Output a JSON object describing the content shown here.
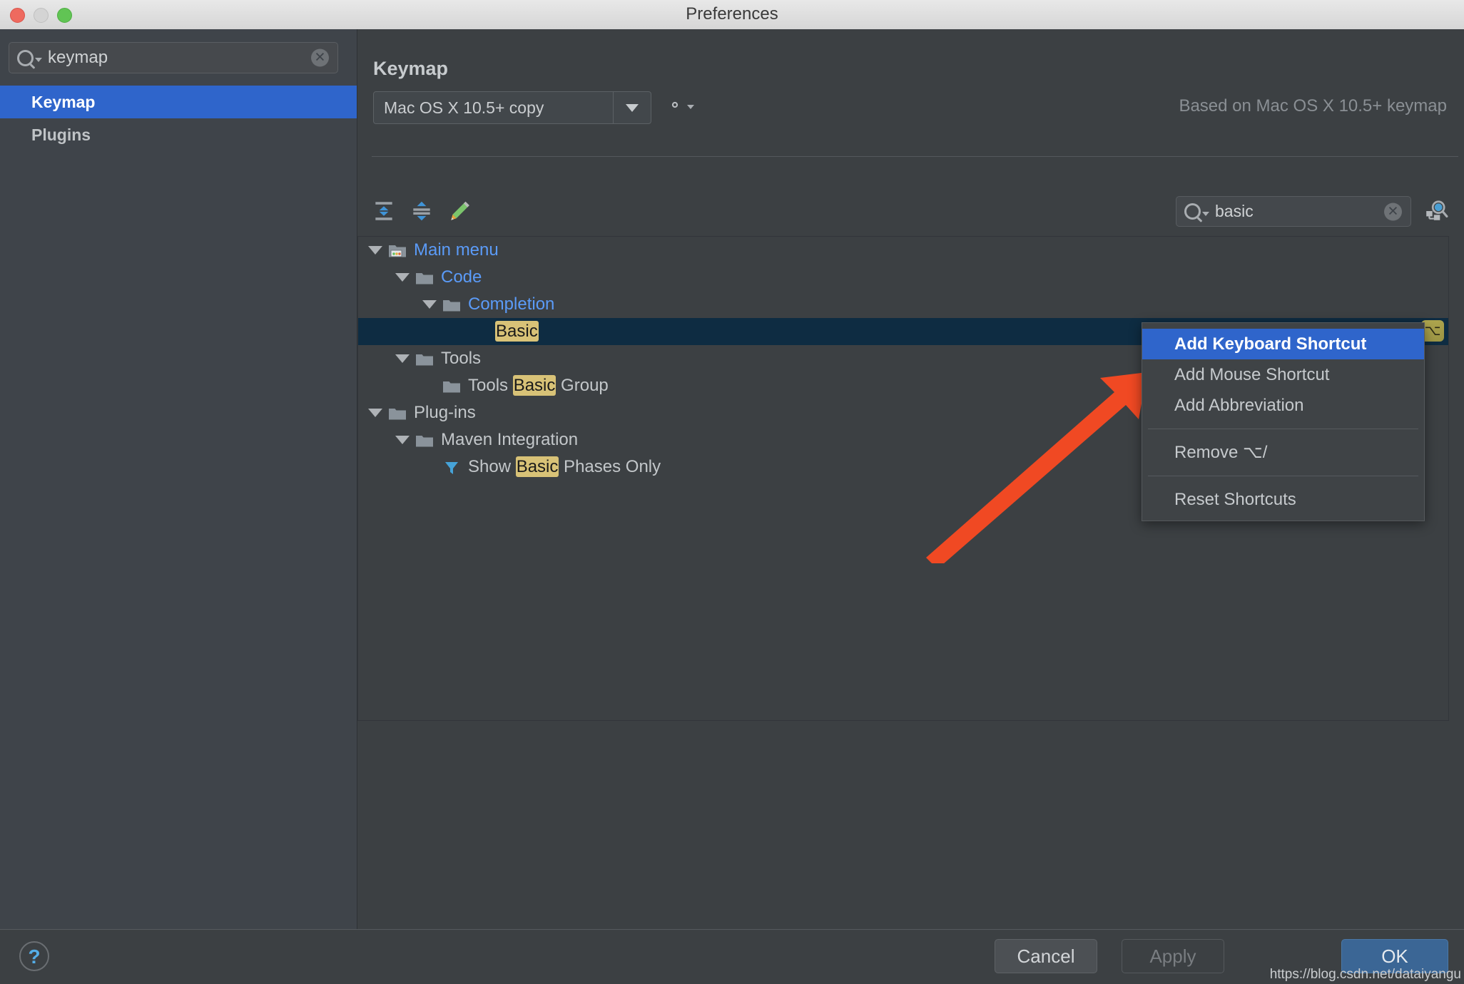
{
  "window": {
    "title": "Preferences",
    "traffic_lights": [
      "close-red",
      "minimize-yellow",
      "zoom-green"
    ]
  },
  "sidebar": {
    "search": {
      "value": "keymap",
      "icon": "search-icon",
      "clear_icon": "clear-icon"
    },
    "items": [
      {
        "label": "Keymap",
        "active": true
      },
      {
        "label": "Plugins",
        "active": false
      }
    ]
  },
  "main": {
    "title": "Keymap",
    "keymap_select": {
      "value": "Mac OS X 10.5+ copy",
      "arrow_icon": "chevron-down-icon"
    },
    "gear_label": "",
    "based_on": "Based on Mac OS X 10.5+ keymap",
    "toolbar": {
      "expand_all": "expand-all-icon",
      "collapse_all": "collapse-all-icon",
      "edit": "edit-pencil-icon"
    },
    "tree_search": {
      "value": "basic",
      "icon": "search-icon",
      "clear_icon": "clear-icon"
    },
    "find_by_shortcut": "find-by-shortcut-icon",
    "tree": [
      {
        "indent": 0,
        "twisty": "expanded",
        "icon": "main-menu-icon",
        "style": "blue",
        "parts": [
          {
            "t": "Main menu",
            "h": false
          }
        ]
      },
      {
        "indent": 1,
        "twisty": "expanded",
        "icon": "folder-icon",
        "style": "blue",
        "parts": [
          {
            "t": "Code",
            "h": false
          }
        ]
      },
      {
        "indent": 2,
        "twisty": "expanded",
        "icon": "folder-icon",
        "style": "blue",
        "parts": [
          {
            "t": "Completion",
            "h": false
          }
        ]
      },
      {
        "indent": 3,
        "twisty": "none",
        "icon": "none",
        "style": "gray",
        "selected": true,
        "badge": "⌥",
        "parts": [
          {
            "t": "Basic",
            "h": true
          }
        ]
      },
      {
        "indent": 1,
        "twisty": "expanded",
        "icon": "folder-icon",
        "style": "gray",
        "parts": [
          {
            "t": "Tools",
            "h": false
          }
        ]
      },
      {
        "indent": 2,
        "twisty": "none",
        "icon": "folder-icon",
        "style": "gray",
        "parts": [
          {
            "t": "Tools ",
            "h": false
          },
          {
            "t": "Basic",
            "h": true
          },
          {
            "t": " Group",
            "h": false
          }
        ]
      },
      {
        "indent": 0,
        "twisty": "expanded",
        "icon": "folder-icon",
        "style": "gray",
        "parts": [
          {
            "t": "Plug-ins",
            "h": false
          }
        ]
      },
      {
        "indent": 1,
        "twisty": "expanded",
        "icon": "folder-icon",
        "style": "gray",
        "parts": [
          {
            "t": "Maven Integration",
            "h": false
          }
        ]
      },
      {
        "indent": 2,
        "twisty": "none",
        "icon": "filter-icon",
        "style": "gray",
        "parts": [
          {
            "t": "Show ",
            "h": false
          },
          {
            "t": "Basic",
            "h": true
          },
          {
            "t": " Phases Only",
            "h": false
          }
        ]
      }
    ]
  },
  "context_menu": {
    "items": [
      {
        "label": "Add Keyboard Shortcut",
        "highlighted": true
      },
      {
        "label": "Add Mouse Shortcut",
        "highlighted": false
      },
      {
        "label": "Add Abbreviation",
        "highlighted": false
      },
      {
        "separator": true
      },
      {
        "label": "Remove ⌥/",
        "highlighted": false
      },
      {
        "separator": true
      },
      {
        "label": "Reset Shortcuts",
        "highlighted": false
      }
    ]
  },
  "annotation": {
    "arrow_color": "#F04923"
  },
  "footer": {
    "help_label": "?",
    "cancel_label": "Cancel",
    "apply_label": "Apply",
    "ok_label": "OK"
  },
  "watermark": "https://blog.csdn.net/dataiyangu",
  "colors": {
    "accent_blue": "#2f65cb",
    "link_blue": "#5b9bf8",
    "highlight_yellow": "#d8c277",
    "selected_row": "#0e2c42",
    "ok_button": "#3b6695"
  }
}
